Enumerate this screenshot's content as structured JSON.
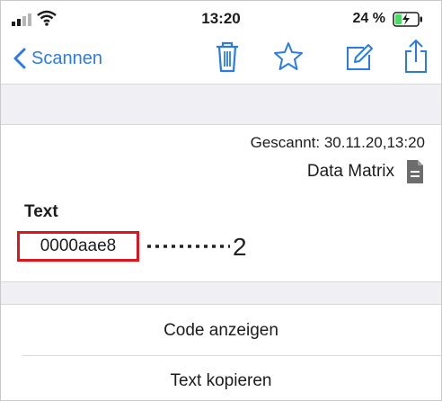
{
  "status_bar": {
    "time": "13:20",
    "battery_percent": "24 %"
  },
  "nav": {
    "back_label": "Scannen"
  },
  "scan": {
    "scanned_text": "Gescannt: 30.11.20,13:20",
    "code_type": "Data Matrix",
    "text_heading": "Text",
    "text_value": "0000aae8",
    "annotation_marker": "2"
  },
  "actions": {
    "show_code": "Code anzeigen",
    "copy_text": "Text kopieren"
  },
  "colors": {
    "accent": "#2c7be5",
    "highlight": "#e0141c",
    "band": "#efeff4"
  }
}
